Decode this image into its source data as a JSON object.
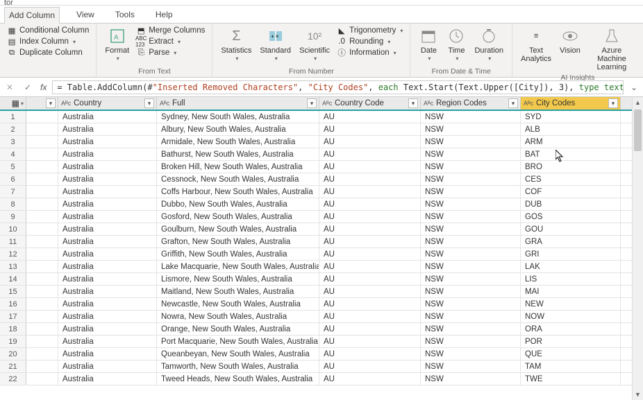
{
  "title": "tor",
  "tabs": {
    "addColumn": "Add Column",
    "view": "View",
    "tools": "Tools",
    "help": "Help"
  },
  "ribbon": {
    "general": {
      "conditional": "Conditional Column",
      "index": "Index Column",
      "duplicate": "Duplicate Column"
    },
    "fromText": {
      "format": "Format",
      "merge": "Merge Columns",
      "extract": "Extract",
      "parse": "Parse",
      "label": "From Text"
    },
    "fromNumber": {
      "statistics": "Statistics",
      "standard": "Standard",
      "scientific": "Scientific",
      "trig": "Trigonometry",
      "rounding": "Rounding",
      "info": "Information",
      "label": "From Number"
    },
    "fromDate": {
      "date": "Date",
      "time": "Time",
      "duration": "Duration",
      "label": "From Date & Time"
    },
    "ai": {
      "textAnalytics": "Text\nAnalytics",
      "vision": "Vision",
      "aml": "Azure Machine\nLearning",
      "label": "AI Insights"
    }
  },
  "formula": {
    "prefix": "= Table.AddColumn(#",
    "arg1": "\"Inserted Removed Characters\"",
    "sep1": ", ",
    "arg2": "\"City Codes\"",
    "sep2": ", ",
    "each": "each",
    "body": " Text.Start(Text.Upper([City]), 3), ",
    "typeKw": "type text",
    "suffix": ")"
  },
  "columns": {
    "country": "Country",
    "full": "Full",
    "cc": "Country Code",
    "region": "Region Codes",
    "city": "City Codes",
    "typeABC": "Aᴮᴄ"
  },
  "rows": [
    {
      "n": 1,
      "country": "Australia",
      "full": "Sydney, New South Wales, Australia",
      "cc": "AU",
      "region": "NSW",
      "city": "SYD"
    },
    {
      "n": 2,
      "country": "Australia",
      "full": "Albury, New South Wales, Australia",
      "cc": "AU",
      "region": "NSW",
      "city": "ALB"
    },
    {
      "n": 3,
      "country": "Australia",
      "full": "Armidale, New South Wales, Australia",
      "cc": "AU",
      "region": "NSW",
      "city": "ARM"
    },
    {
      "n": 4,
      "country": "Australia",
      "full": "Bathurst, New South Wales, Australia",
      "cc": "AU",
      "region": "NSW",
      "city": "BAT"
    },
    {
      "n": 5,
      "country": "Australia",
      "full": "Broken Hill, New South Wales, Australia",
      "cc": "AU",
      "region": "NSW",
      "city": "BRO"
    },
    {
      "n": 6,
      "country": "Australia",
      "full": "Cessnock, New South Wales, Australia",
      "cc": "AU",
      "region": "NSW",
      "city": "CES"
    },
    {
      "n": 7,
      "country": "Australia",
      "full": "Coffs Harbour, New South Wales, Australia",
      "cc": "AU",
      "region": "NSW",
      "city": "COF"
    },
    {
      "n": 8,
      "country": "Australia",
      "full": "Dubbo, New South Wales, Australia",
      "cc": "AU",
      "region": "NSW",
      "city": "DUB"
    },
    {
      "n": 9,
      "country": "Australia",
      "full": "Gosford, New South Wales, Australia",
      "cc": "AU",
      "region": "NSW",
      "city": "GOS"
    },
    {
      "n": 10,
      "country": "Australia",
      "full": "Goulburn, New South Wales, Australia",
      "cc": "AU",
      "region": "NSW",
      "city": "GOU"
    },
    {
      "n": 11,
      "country": "Australia",
      "full": "Grafton, New South Wales, Australia",
      "cc": "AU",
      "region": "NSW",
      "city": "GRA"
    },
    {
      "n": 12,
      "country": "Australia",
      "full": "Griffith, New South Wales, Australia",
      "cc": "AU",
      "region": "NSW",
      "city": "GRI"
    },
    {
      "n": 13,
      "country": "Australia",
      "full": "Lake Macquarie, New South Wales, Australia",
      "cc": "AU",
      "region": "NSW",
      "city": "LAK"
    },
    {
      "n": 14,
      "country": "Australia",
      "full": "Lismore, New South Wales, Australia",
      "cc": "AU",
      "region": "NSW",
      "city": "LIS"
    },
    {
      "n": 15,
      "country": "Australia",
      "full": "Maitland, New South Wales, Australia",
      "cc": "AU",
      "region": "NSW",
      "city": "MAI"
    },
    {
      "n": 16,
      "country": "Australia",
      "full": "Newcastle, New South Wales, Australia",
      "cc": "AU",
      "region": "NSW",
      "city": "NEW"
    },
    {
      "n": 17,
      "country": "Australia",
      "full": "Nowra, New South Wales, Australia",
      "cc": "AU",
      "region": "NSW",
      "city": "NOW"
    },
    {
      "n": 18,
      "country": "Australia",
      "full": "Orange, New South Wales, Australia",
      "cc": "AU",
      "region": "NSW",
      "city": "ORA"
    },
    {
      "n": 19,
      "country": "Australia",
      "full": "Port Macquarie, New South Wales, Australia",
      "cc": "AU",
      "region": "NSW",
      "city": "POR"
    },
    {
      "n": 20,
      "country": "Australia",
      "full": "Queanbeyan, New South Wales, Australia",
      "cc": "AU",
      "region": "NSW",
      "city": "QUE"
    },
    {
      "n": 21,
      "country": "Australia",
      "full": "Tamworth, New South Wales, Australia",
      "cc": "AU",
      "region": "NSW",
      "city": "TAM"
    },
    {
      "n": 22,
      "country": "Australia",
      "full": "Tweed Heads, New South Wales, Australia",
      "cc": "AU",
      "region": "NSW",
      "city": "TWE"
    }
  ]
}
